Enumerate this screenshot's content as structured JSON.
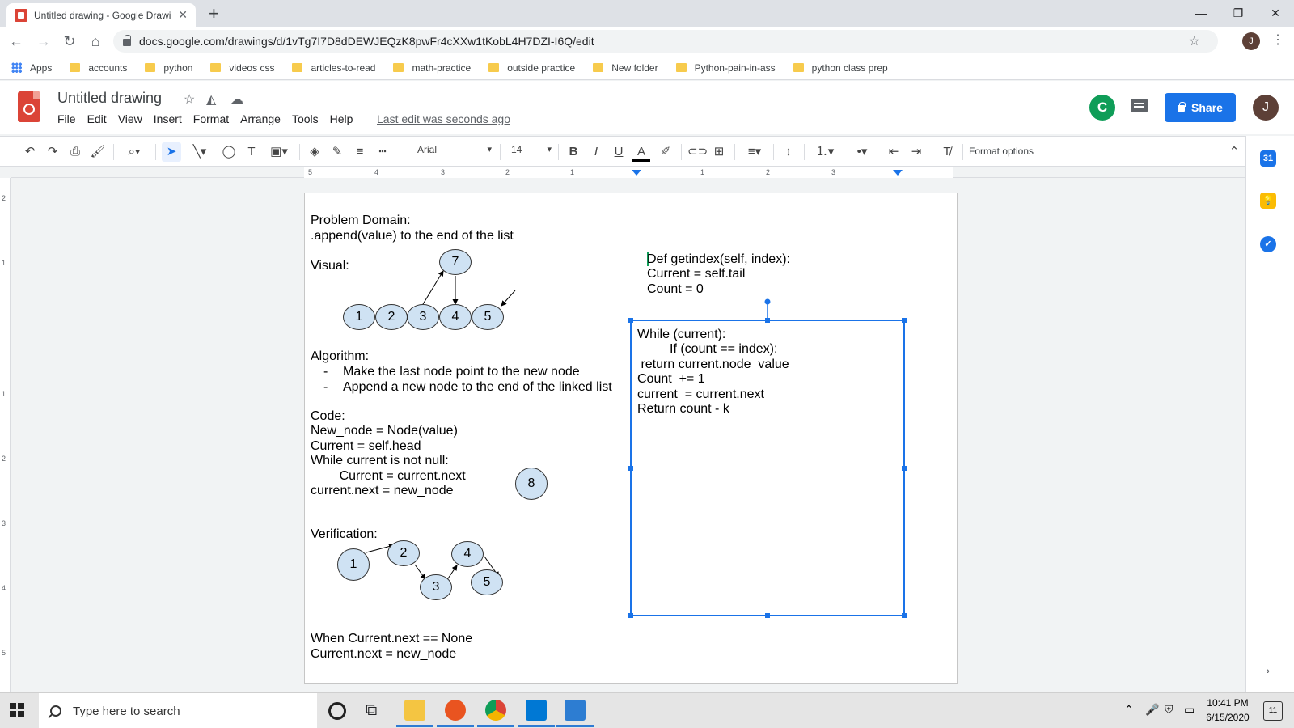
{
  "browser": {
    "tab_title": "Untitled drawing - Google Drawi",
    "tab_close": "✕",
    "new_tab": "+",
    "window_controls": [
      "—",
      "❐",
      "✕"
    ],
    "url": "docs.google.com/drawings/d/1vTg7I7D8dDEWJEQzK8pwFr4cXXw1tKobL4H7DZI-I6Q/edit",
    "profile_initial": "J",
    "bookmarks": [
      "Apps",
      "accounts",
      "python",
      "videos css",
      "articles-to-read",
      "math-practice",
      "outside practice",
      "New folder",
      "Python-pain-in-ass",
      "python class prep"
    ]
  },
  "app": {
    "doc_title": "Untitled drawing",
    "menu": [
      "File",
      "Edit",
      "View",
      "Insert",
      "Format",
      "Arrange",
      "Tools",
      "Help"
    ],
    "last_edit": "Last edit was seconds ago",
    "collaborator_initial": "C",
    "share_label": "Share",
    "user_initial": "J",
    "font_name": "Arial",
    "font_size": "14",
    "format_options": "Format options",
    "colors": {
      "share": "#1a73e8",
      "node_fill": "#cfe2f3",
      "selection": "#1a73e8"
    }
  },
  "ruler": {
    "horizontal": [
      "5",
      "4",
      "3",
      "2",
      "1",
      "1",
      "2",
      "3"
    ],
    "vertical": [
      "2",
      "1",
      "1",
      "2",
      "3",
      "4",
      "5"
    ]
  },
  "drawing": {
    "problem_domain": "Problem Domain:",
    "append_desc": ".append(value) to the end of the list",
    "visual_label": "Visual:",
    "visual_nodes": [
      "1",
      "2",
      "3",
      "4",
      "5",
      "7"
    ],
    "algorithm_label": "Algorithm:",
    "algorithm_steps": [
      "Make the last node point to the new node",
      "Append a new node to the end of the linked list"
    ],
    "algorithm_bullet": "-",
    "code_label": "Code:",
    "code_lines": [
      "New_node = Node(value)",
      "Current = self.head",
      "While current is not null:",
      "        Current = current.next",
      "current.next = new_node"
    ],
    "extra_node": "8",
    "verification_label": "Verification:",
    "verification_nodes": [
      "1",
      "2",
      "3",
      "4",
      "5"
    ],
    "footer_lines": [
      "When Current.next == None",
      "Current.next = new_node"
    ],
    "getindex_lines": [
      "Def getindex(self, index):",
      "Current = self.tail",
      "Count = 0"
    ],
    "loop_lines": [
      "While (current):",
      "         If (count == index):",
      " return current.node_value",
      "Count  += 1",
      "current  = current.next",
      "Return count - k"
    ]
  },
  "taskbar": {
    "search_placeholder": "Type here to search",
    "time": "10:41 PM",
    "date": "6/15/2020",
    "notification_count": "11"
  }
}
